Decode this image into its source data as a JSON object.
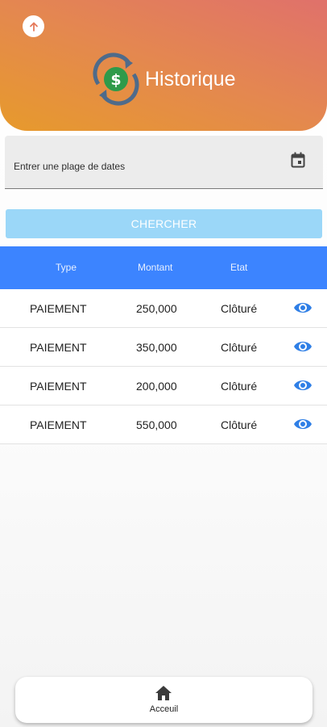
{
  "header": {
    "title": "Historique",
    "back_icon": "arrow-up-icon",
    "logo_icon": "dollar-refresh-icon",
    "gradient_colors": [
      "#e0716b",
      "#e79a2c"
    ]
  },
  "filter": {
    "date_label": "Entrer une plage de dates",
    "calendar_icon": "calendar-icon",
    "search_label": "CHERCHER"
  },
  "table": {
    "header_color": "#3c84ff",
    "columns": [
      "Type",
      "Montant",
      "Etat"
    ],
    "rows": [
      {
        "type": "PAIEMENT",
        "amount": "250,000",
        "state": "Clôturé"
      },
      {
        "type": "PAIEMENT",
        "amount": "350,000",
        "state": "Clôturé"
      },
      {
        "type": "PAIEMENT",
        "amount": "200,000",
        "state": "Clôturé"
      },
      {
        "type": "PAIEMENT",
        "amount": "550,000",
        "state": "Clôturé"
      }
    ],
    "view_icon": "eye-icon",
    "view_icon_color": "#2f7fe6"
  },
  "bottom_nav": {
    "home_label": "Acceuil",
    "home_icon": "home-icon"
  }
}
